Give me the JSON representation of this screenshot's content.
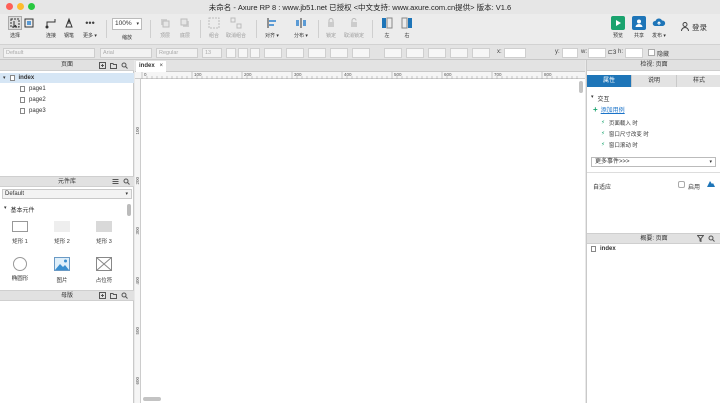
{
  "window": {
    "title": "未命名 - Axure RP 8 : www.jb51.net 已授权    <中文支持: www.axure.com.cn提供> 版本: V1.6",
    "traffic_lights": [
      "#fe5f57",
      "#febc2e",
      "#28c840"
    ]
  },
  "toolbar": {
    "select": "选择",
    "connect": "连接",
    "pen": "钢笔",
    "more": "更多 ▾",
    "zoom_value": "100%",
    "zoom_label": "缩放",
    "top": "顶层",
    "bottom": "底层",
    "group": "组合",
    "ungroup": "取消组合",
    "align": "对齐 ▾",
    "distribute": "分布 ▾",
    "lock": "锁定",
    "unlock": "取消锁定",
    "left": "左",
    "right": "右",
    "preview": "预览",
    "share": "共享",
    "publish": "发布 ▾",
    "login": "登录"
  },
  "formatbar": {
    "style": "Default",
    "font": "Arial",
    "weight": "Regular",
    "size": "13",
    "x": "x:",
    "y": "y:",
    "w": "w:",
    "h": "h:",
    "hidden": "隐藏"
  },
  "pages_panel": {
    "title": "页面",
    "pages": [
      {
        "name": "index",
        "selected": true
      },
      {
        "name": "page1"
      },
      {
        "name": "page2"
      },
      {
        "name": "page3"
      }
    ]
  },
  "library_panel": {
    "title": "元件库",
    "selected_library": "Default",
    "section": "基本元件",
    "items": [
      "矩形 1",
      "矩形 2",
      "矩形 3",
      "椭圆形",
      "图片",
      "占位符"
    ]
  },
  "masters_panel": {
    "title": "母版"
  },
  "canvas": {
    "tab": "index",
    "ruler_x": [
      "0",
      "100",
      "200",
      "300",
      "400",
      "500",
      "600",
      "700",
      "800",
      "900"
    ],
    "ruler_y": [
      "100",
      "200",
      "300",
      "400",
      "500",
      "600"
    ]
  },
  "inspector": {
    "title": "检视: 页面",
    "tabs": [
      "属性",
      "说明",
      "样式"
    ],
    "interaction": "交互",
    "add_case": "添加用例",
    "events": [
      "页面载入 时",
      "窗口尺寸改变 时",
      "窗口滚动 时"
    ],
    "more_events": "更多事件>>>",
    "adaptive": "自适应",
    "enable": "启用"
  },
  "outline_panel": {
    "title": "概要: 页面",
    "root": "index"
  }
}
